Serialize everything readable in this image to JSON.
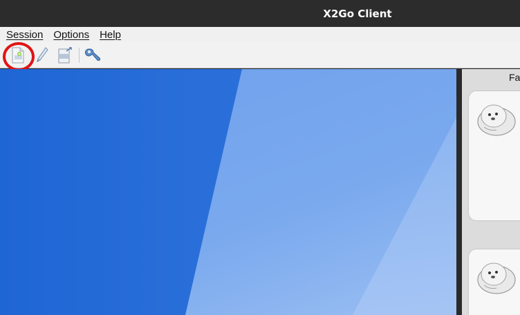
{
  "window": {
    "title": "X2Go Client"
  },
  "menu": {
    "items": [
      "Session",
      "Options",
      "Help"
    ]
  },
  "toolbar": {
    "buttons": [
      {
        "icon": "new-session-icon"
      },
      {
        "icon": "edit-session-icon"
      },
      {
        "icon": "export-session-icon"
      },
      {
        "icon": "settings-wrench-icon"
      }
    ]
  },
  "sidepanel": {
    "favorites_label": "Fav"
  },
  "colors": {
    "titlebar": "#2c2c2c",
    "highlight": "#e01414",
    "desktop": "#1f66d5"
  }
}
